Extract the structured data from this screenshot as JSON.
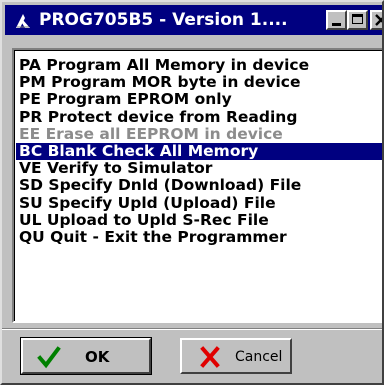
{
  "window": {
    "title": "PROG705B5 - Version 1...."
  },
  "icons": {
    "app": "app-logo-icon",
    "minimize": "minimize-icon",
    "maximize": "maximize-icon",
    "close": "close-icon",
    "ok": "checkmark-icon",
    "cancel": "x-mark-icon"
  },
  "colors": {
    "titlebar": "#000080",
    "selection": "#000080",
    "disabled_text": "#8c8c8c",
    "ok_check": "#008000",
    "cancel_x": "#e00000"
  },
  "list": {
    "items": [
      {
        "label": "PA Program All Memory in device",
        "state": "normal"
      },
      {
        "label": "PM Program MOR byte in device",
        "state": "normal"
      },
      {
        "label": "PE Program EPROM only",
        "state": "normal"
      },
      {
        "label": "PR Protect device from Reading",
        "state": "normal"
      },
      {
        "label": "EE Erase all EEPROM in device",
        "state": "disabled"
      },
      {
        "label": "BC Blank Check All Memory",
        "state": "selected"
      },
      {
        "label": "VE Verify to Simulator",
        "state": "normal"
      },
      {
        "label": "SD Specify Dnld (Download) File",
        "state": "normal"
      },
      {
        "label": "SU Specify Upld (Upload) File",
        "state": "normal"
      },
      {
        "label": "UL Upload to Upld S-Rec File",
        "state": "normal"
      },
      {
        "label": "QU Quit - Exit the Programmer",
        "state": "normal"
      }
    ]
  },
  "buttons": {
    "ok_label": "OK",
    "cancel_label": "Cancel"
  }
}
